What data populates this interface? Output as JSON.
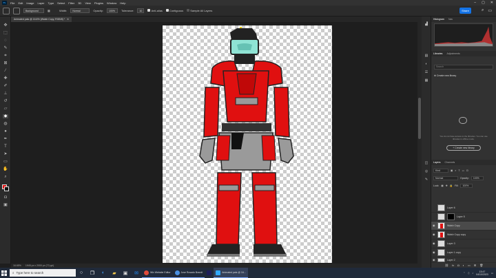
{
  "menubar": {
    "items": [
      "File",
      "Edit",
      "Image",
      "Layer",
      "Type",
      "Select",
      "Filter",
      "3D",
      "View",
      "Plugins",
      "Window",
      "Help"
    ]
  },
  "options": {
    "mode": "Background",
    "width_label": "Width:",
    "width_value": "Normal",
    "opacity_label": "Opacity:",
    "opacity_value": "100%",
    "tolerance_label": "Tolerance:",
    "tolerance_value": "10",
    "antialias_label": "Anti-alias",
    "contiguous_label": "Contiguous",
    "sample_label": "Sample All Layers",
    "share_label": "Share"
  },
  "document": {
    "tab_title": "Animated pals @ 16.6% (Walsh Copy, RGB/8) *"
  },
  "statusbar": {
    "zoom": "16.65%",
    "info": "1945 px x 2000 px (72 ppi)"
  },
  "panels": {
    "top_tabs": [
      "Histogram",
      "Nav"
    ],
    "lib_tabs": [
      "Libraries",
      "Adjustments"
    ],
    "lib_search_placeholder": "Search",
    "create_lib_row": "Create new library",
    "empty_text": "You do not have access to the libraries. You can use libraries in offline mode.",
    "create_lib_button": "+ Create new library",
    "layers_tabs": [
      "Layers",
      "Channels"
    ],
    "kind_label": "Kind",
    "blend_mode": "Normal",
    "opacity_label": "Opacity:",
    "opacity_value": "100%",
    "lock_label": "Lock:",
    "fill_label": "Fill:",
    "fill_value": "100%"
  },
  "layers": [
    {
      "name": "Layer 6",
      "thumb": "plain",
      "visible": false,
      "selected": false
    },
    {
      "name": "Layer 5",
      "thumb": "mask",
      "visible": false,
      "selected": false
    },
    {
      "name": "Walsh Copy",
      "thumb": "figure",
      "visible": true,
      "selected": true
    },
    {
      "name": "Walsh Copy copy",
      "thumb": "figure",
      "visible": true,
      "selected": false
    },
    {
      "name": "Layer 3",
      "thumb": "plain",
      "visible": true,
      "selected": false
    },
    {
      "name": "Layer 1 copy",
      "thumb": "plain",
      "visible": true,
      "selected": false
    },
    {
      "name": "Layer 2",
      "thumb": "plain",
      "visible": true,
      "selected": false
    }
  ],
  "taskbar": {
    "search_placeholder": "Type here to search",
    "apps": [
      {
        "label": "Wix Website Editor",
        "color": "#e04a3a"
      },
      {
        "label": "Jose Rosado Brandt",
        "color": "#4a90e2"
      },
      {
        "label": "",
        "color": "#1e1e5a"
      },
      {
        "label": "Animated pals @ 16...",
        "color": "#31a8ff"
      }
    ],
    "time": "13:47",
    "date": "04/10/2023"
  },
  "colors": {
    "accent": "#1473e6",
    "armor_red": "#e01010",
    "armor_grey": "#9a9a9a",
    "visor": "#8fe3d4"
  }
}
